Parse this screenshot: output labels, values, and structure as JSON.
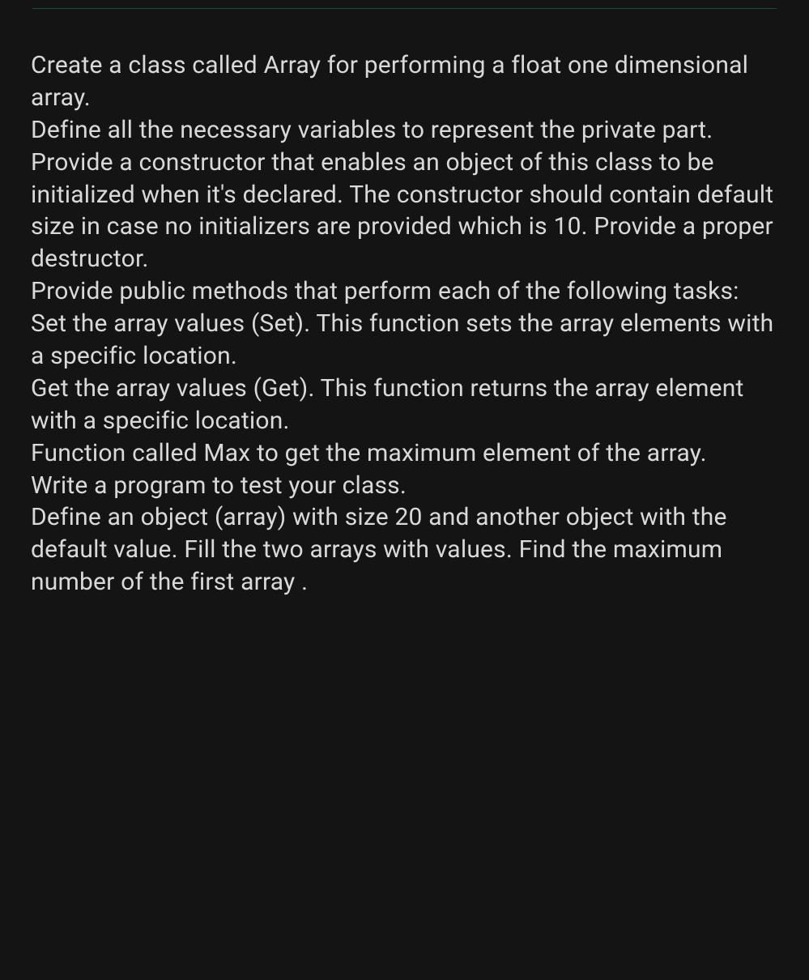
{
  "doc": {
    "p1": "Create a class called Array for performing a float one dimensional array.",
    "p2": "Define all the necessary variables to represent the private part. Provide a constructor that enables an object of this class to be initialized when it's declared. The constructor should contain default size in case no initializers are provided which is 10. Provide a proper destructor.",
    "p3": "Provide public methods that perform each of the following tasks:",
    "p4": "Set the array values (Set). This function sets the array elements with a specific location.",
    "p5": "Get the array values (Get). This function returns the array element with a specific location.",
    "p6": "Function called Max to get the maximum element of the array.",
    "p7": "Write a program to test your class.",
    "p8": "Define an object (array) with size 20 and another object with the default value. Fill the two arrays with values. Find the maximum number of the first array ."
  }
}
